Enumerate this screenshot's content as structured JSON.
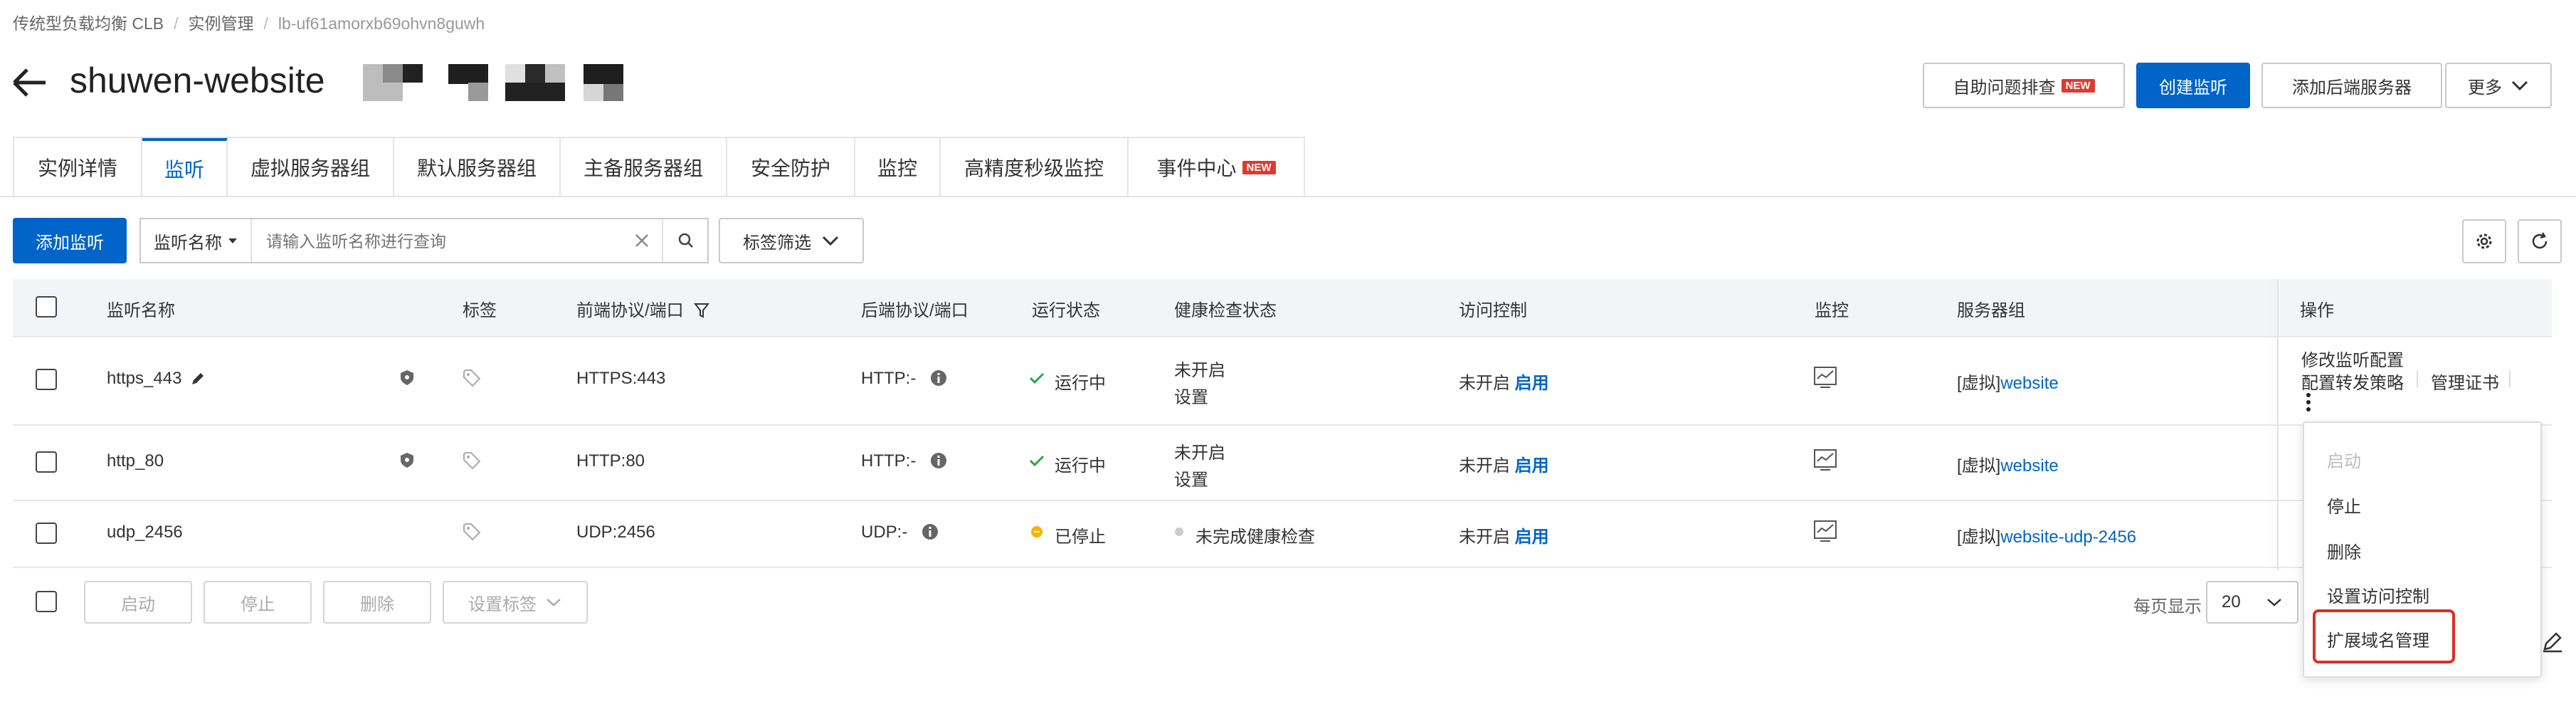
{
  "breadcrumb": {
    "items": [
      "传统型负载均衡 CLB",
      "实例管理"
    ],
    "current": "lb-uf61amorxb69ohvn8guwh"
  },
  "header": {
    "title": "shuwen-website",
    "buttons": {
      "troubleshoot": "自助问题排查",
      "troubleshoot_badge": "NEW",
      "create_listener": "创建监听",
      "add_backend": "添加后端服务器",
      "more": "更多"
    }
  },
  "tabs": [
    {
      "label": "实例详情"
    },
    {
      "label": "监听"
    },
    {
      "label": "虚拟服务器组"
    },
    {
      "label": "默认服务器组"
    },
    {
      "label": "主备服务器组"
    },
    {
      "label": "安全防护"
    },
    {
      "label": "监控"
    },
    {
      "label": "高精度秒级监控"
    },
    {
      "label": "事件中心",
      "badge": "NEW"
    }
  ],
  "toolbar": {
    "add_listener": "添加监听",
    "search_field": "监听名称",
    "search_placeholder": "请输入监听名称进行查询",
    "tag_filter": "标签筛选"
  },
  "table": {
    "columns": [
      "监听名称",
      "标签",
      "前端协议/端口",
      "后端协议/端口",
      "运行状态",
      "健康检查状态",
      "访问控制",
      "监控",
      "服务器组",
      "操作"
    ],
    "rows": [
      {
        "name": "https_443",
        "frontend": "HTTPS:443",
        "backend": "HTTP:-",
        "status": "运行中",
        "health": "未开启",
        "health_action": "设置",
        "acl": "未开启",
        "acl_action": "启用",
        "group_prefix": "[虚拟]",
        "group": "website",
        "ops": [
          "修改监听配置",
          "配置转发策略",
          "管理证书"
        ]
      },
      {
        "name": "http_80",
        "frontend": "HTTP:80",
        "backend": "HTTP:-",
        "status": "运行中",
        "health": "未开启",
        "health_action": "设置",
        "acl": "未开启",
        "acl_action": "启用",
        "group_prefix": "[虚拟]",
        "group": "website"
      },
      {
        "name": "udp_2456",
        "frontend": "UDP:2456",
        "backend": "UDP:-",
        "status": "已停止",
        "health": "未完成健康检查",
        "acl": "未开启",
        "acl_action": "启用",
        "group_prefix": "[虚拟]",
        "group": "website-udp-2456"
      }
    ]
  },
  "footer": {
    "start": "启动",
    "stop": "停止",
    "delete": "删除",
    "set_tags": "设置标签",
    "page_size_label": "每页显示",
    "page_size": "20"
  },
  "menu": {
    "items": [
      "启动",
      "停止",
      "删除",
      "设置访问控制",
      "扩展域名管理"
    ]
  },
  "colors": {
    "primary": "#0064c8",
    "success": "#28a745",
    "warning": "#f5b400",
    "badge": "#e03a2f",
    "highlight": "#d93025"
  }
}
